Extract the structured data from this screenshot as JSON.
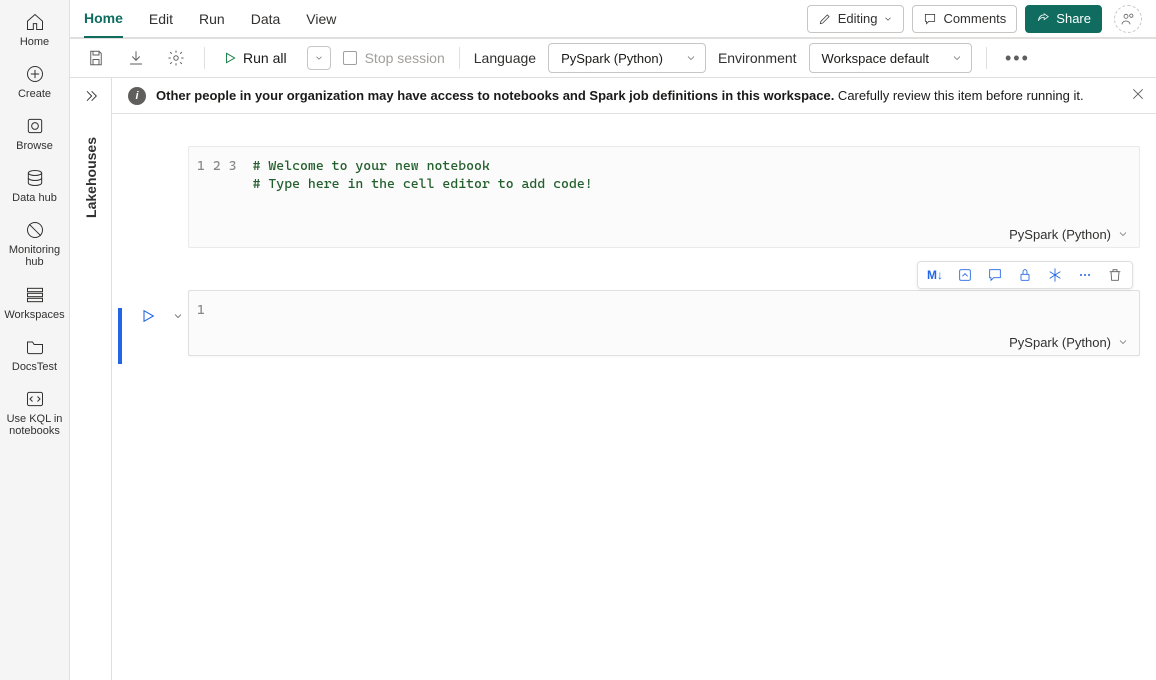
{
  "leftrail": {
    "home": "Home",
    "create": "Create",
    "browse": "Browse",
    "datahub": "Data hub",
    "monitoring": "Monitoring hub",
    "workspaces": "Workspaces",
    "docstest": "DocsTest",
    "kql": "Use KQL in notebooks"
  },
  "menubar": {
    "tabs": [
      "Home",
      "Edit",
      "Run",
      "Data",
      "View"
    ],
    "editing": "Editing",
    "comments": "Comments",
    "share": "Share"
  },
  "toolbar": {
    "runall": "Run all",
    "stop": "Stop session",
    "language_label": "Language",
    "language_select": "PySpark (Python)",
    "env_label": "Environment",
    "env_select": "Workspace default"
  },
  "sidepanel": {
    "title": "Lakehouses"
  },
  "infobar": {
    "bold": "Other people in your organization may have access to notebooks and Spark job definitions in this workspace.",
    "rest": " Carefully review this item before running it."
  },
  "cells": {
    "cell1": {
      "gutter": "1\n2\n3",
      "code": "# Welcome to your new notebook\n# Type here in the cell editor to add code!\n ",
      "lang": "PySpark (Python)"
    },
    "cell2": {
      "gutter": "1",
      "code": " ",
      "lang": "PySpark (Python)"
    },
    "md_label": "M↓"
  }
}
